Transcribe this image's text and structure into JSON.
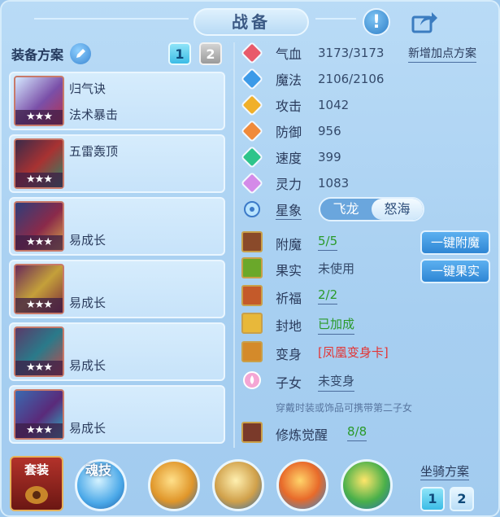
{
  "header": {
    "title": "战备"
  },
  "left": {
    "scheme_label": "装备方案",
    "scheme_tabs": [
      "1",
      "2"
    ],
    "cards": [
      {
        "line1": "归气诀",
        "line2": "法术暴击",
        "stars": "★★★"
      },
      {
        "line1": "五雷轰顶",
        "line2": "",
        "stars": "★★★"
      },
      {
        "line1": "",
        "line2": "易成长",
        "stars": "★★★"
      },
      {
        "line1": "",
        "line2": "易成长",
        "stars": "★★★"
      },
      {
        "line1": "",
        "line2": "易成长",
        "stars": "★★★"
      },
      {
        "line1": "",
        "line2": "易成长",
        "stars": "★★★"
      }
    ]
  },
  "stats": {
    "add_point_scheme": "新增加点方案",
    "hp": {
      "name": "气血",
      "value": "3173/3173"
    },
    "mp": {
      "name": "魔法",
      "value": "2106/2106"
    },
    "atk": {
      "name": "攻击",
      "value": "1042"
    },
    "def": {
      "name": "防御",
      "value": "956"
    },
    "spd": {
      "name": "速度",
      "value": "399"
    },
    "spirit": {
      "name": "灵力",
      "value": "1083"
    },
    "star": {
      "name": "星象",
      "options": [
        "飞龙",
        "怒海"
      ],
      "selected": "怒海"
    }
  },
  "extras": {
    "enchant": {
      "name": "附魔",
      "value": "5/5"
    },
    "fruit": {
      "name": "果实",
      "value": "未使用"
    },
    "bless": {
      "name": "祈福",
      "value": "2/2"
    },
    "seal": {
      "name": "封地",
      "value": "已加成"
    },
    "transform": {
      "name": "变身",
      "value": "[凤凰变身卡]"
    },
    "child": {
      "name": "子女",
      "value": "未变身"
    },
    "hint": "穿戴时装或饰品可携带第二子女",
    "cultivation": {
      "name": "修炼觉醒",
      "value": "8/8"
    },
    "btn_enchant": "一键附魔",
    "btn_fruit": "一键果实"
  },
  "bottom": {
    "suit_label": "套装",
    "soul_label": "魂技",
    "mount_label": "坐骑方案",
    "mount_tabs": [
      "1",
      "2"
    ]
  },
  "colors": {
    "green_text": "#2a9a2a",
    "red_text": "#e33535",
    "button_blue": "#2e86d4"
  }
}
